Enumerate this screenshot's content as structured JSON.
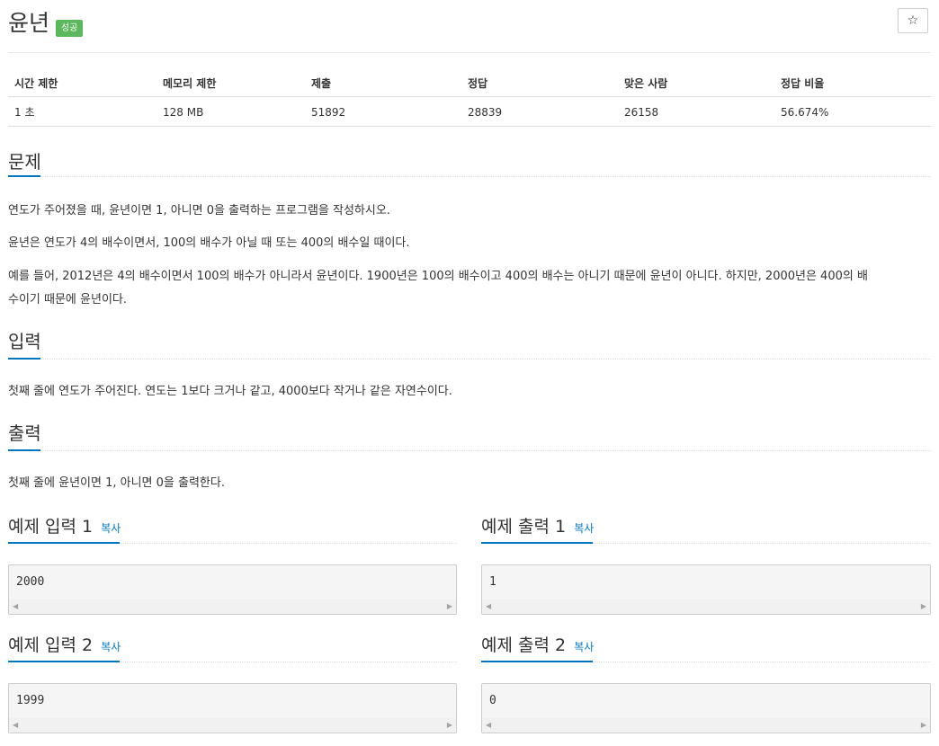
{
  "header": {
    "title": "윤년",
    "badge": "성공",
    "star_icon": "☆"
  },
  "info_table": {
    "headers": [
      "시간 제한",
      "메모리 제한",
      "제출",
      "정답",
      "맞은 사람",
      "정답 비율"
    ],
    "values": [
      "1 초",
      "128 MB",
      "51892",
      "28839",
      "26158",
      "56.674%"
    ]
  },
  "problem": {
    "title": "문제",
    "paragraphs": [
      "연도가 주어졌을 때, 윤년이면 1, 아니면 0을 출력하는 프로그램을 작성하시오.",
      "윤년은 연도가 4의 배수이면서, 100의 배수가 아닐 때 또는 400의 배수일 때이다.",
      "예를 들어, 2012년은 4의 배수이면서 100의 배수가 아니라서 윤년이다. 1900년은 100의 배수이고 400의 배수는 아니기 때문에 윤년이 아니다. 하지만, 2000년은 400의 배",
      "수이기 때문에 윤년이다."
    ]
  },
  "input_section": {
    "title": "입력",
    "text": "첫째 줄에 연도가 주어진다. 연도는 1보다 크거나 같고, 4000보다 작거나 같은 자연수이다."
  },
  "output_section": {
    "title": "출력",
    "text": "첫째 줄에 윤년이면 1, 아니면 0을 출력한다."
  },
  "samples": {
    "copy_label": "복사",
    "input1_title": "예제 입력 1",
    "output1_title": "예제 출력 1",
    "input2_title": "예제 입력 2",
    "output2_title": "예제 출력 2",
    "input1_value": "2000",
    "output1_value": "1",
    "input2_value": "1999",
    "output2_value": "0"
  },
  "colors": {
    "accent": "#0076c0",
    "success_badge": "#5cb85c"
  }
}
